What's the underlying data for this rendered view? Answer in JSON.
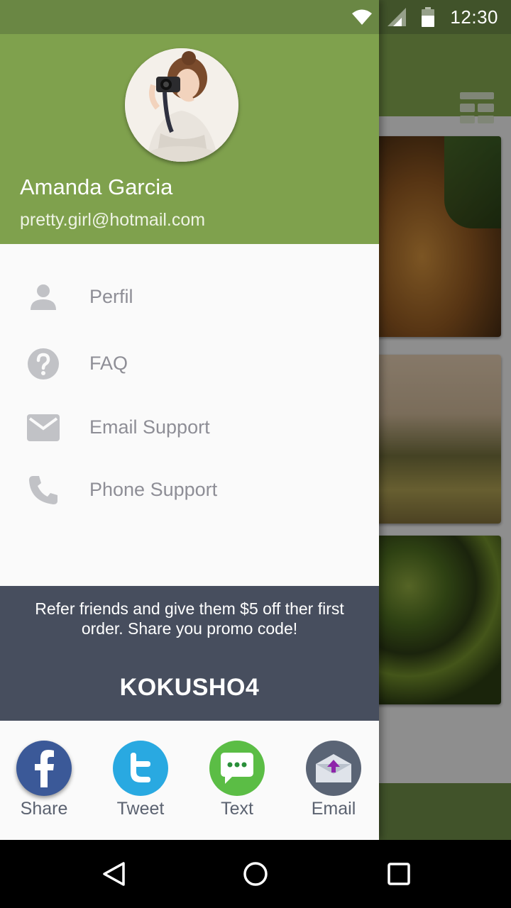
{
  "status_bar": {
    "time": "12:30",
    "icons": [
      "wifi-icon",
      "signal-icon",
      "battery-icon"
    ]
  },
  "toolbar": {
    "menu_icon": "grid-menu-icon"
  },
  "drawer": {
    "header": {
      "name": "Amanda Garcia",
      "email": "pretty.girl@hotmail.com",
      "avatar": "profile-photo"
    },
    "menu": [
      {
        "label": "Perfil",
        "icon": "person-icon"
      },
      {
        "label": "FAQ",
        "icon": "help-icon"
      },
      {
        "label": "Email Support",
        "icon": "mail-icon"
      },
      {
        "label": "Phone Support",
        "icon": "phone-icon"
      }
    ],
    "promo": {
      "text": "Refer friends and give them $5 off ther first order. Share you promo code!",
      "code": "KOKUSHO4"
    },
    "share": [
      {
        "label": "Share",
        "icon": "facebook-icon",
        "color": "#3b5998"
      },
      {
        "label": "Tweet",
        "icon": "twitter-icon",
        "color": "#29a9e1"
      },
      {
        "label": "Text",
        "icon": "message-icon",
        "color": "#5bbd45"
      },
      {
        "label": "Email",
        "icon": "email-icon",
        "color": "#5a6475"
      }
    ]
  },
  "colors": {
    "primary": "#7fa14d",
    "primary_dark": "#6a8744",
    "promo_bg": "#474e5e",
    "menu_text": "#8e8e96"
  },
  "nav_bar": {
    "buttons": [
      "back-icon",
      "home-icon",
      "recents-icon"
    ]
  }
}
